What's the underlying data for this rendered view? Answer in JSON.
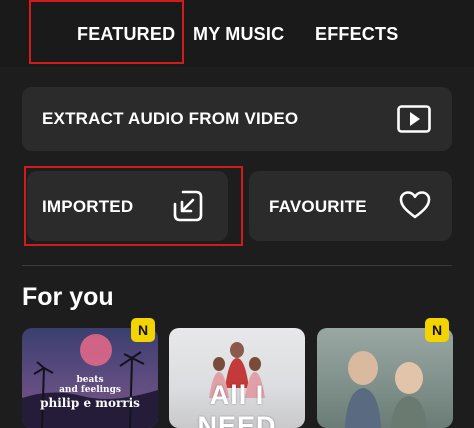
{
  "tabs": [
    {
      "label": "FEATURED",
      "active": true
    },
    {
      "label": "MY MUSIC",
      "active": false
    },
    {
      "label": "EFFECTS",
      "active": false
    }
  ],
  "actions": {
    "extract": {
      "label": "EXTRACT AUDIO FROM VIDEO",
      "icon": "play-video-icon"
    },
    "imported": {
      "label": "IMPORTED",
      "icon": "import-arrow-icon"
    },
    "favourite": {
      "label": "FAVOURITE",
      "icon": "heart-icon"
    }
  },
  "section": {
    "title": "For you"
  },
  "albums": [
    {
      "cover_text": [
        "beats",
        "and feelings",
        "philip e morris"
      ],
      "badge": "N"
    },
    {
      "cover_text": [
        "All I NEED"
      ],
      "badge": ""
    },
    {
      "cover_text": [],
      "badge": "N"
    }
  ],
  "colors": {
    "background": "#1d1d1d",
    "card": "#2b2b2b",
    "highlight": "#d31b1b",
    "badge": "#f4d400"
  }
}
